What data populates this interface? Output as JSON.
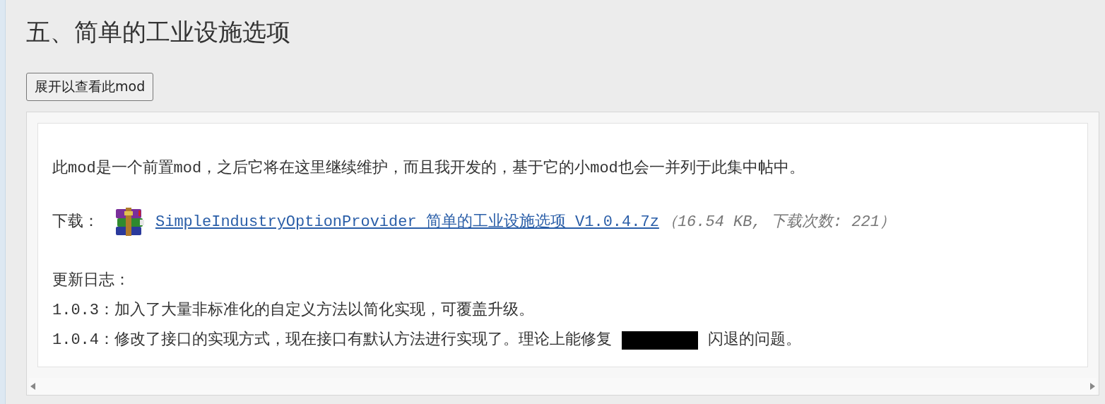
{
  "heading": "五、简单的工业设施选项",
  "expand_button": "展开以查看此mod",
  "intro": "此mod是一个前置mod，之后它将在这里继续维护，而且我开发的，基于它的小mod也会一并列于此集中帖中。",
  "download": {
    "label": "下载：",
    "link": "SimpleIndustryOptionProvider 简单的工业设施选项 V1.0.4.7z",
    "meta": "（16.54 KB, 下载次数: 221）"
  },
  "changelog": {
    "title": "更新日志：",
    "entries": [
      {
        "text": "1.0.3：加入了大量非标准化的自定义方法以简化实现，可覆盖升级。",
        "redacted": false
      },
      {
        "text": "1.0.4：修改了接口的实现方式，现在接口有默认方法进行实现了。理论上能修复",
        "redacted": true,
        "after": "闪退的问题。"
      }
    ]
  }
}
